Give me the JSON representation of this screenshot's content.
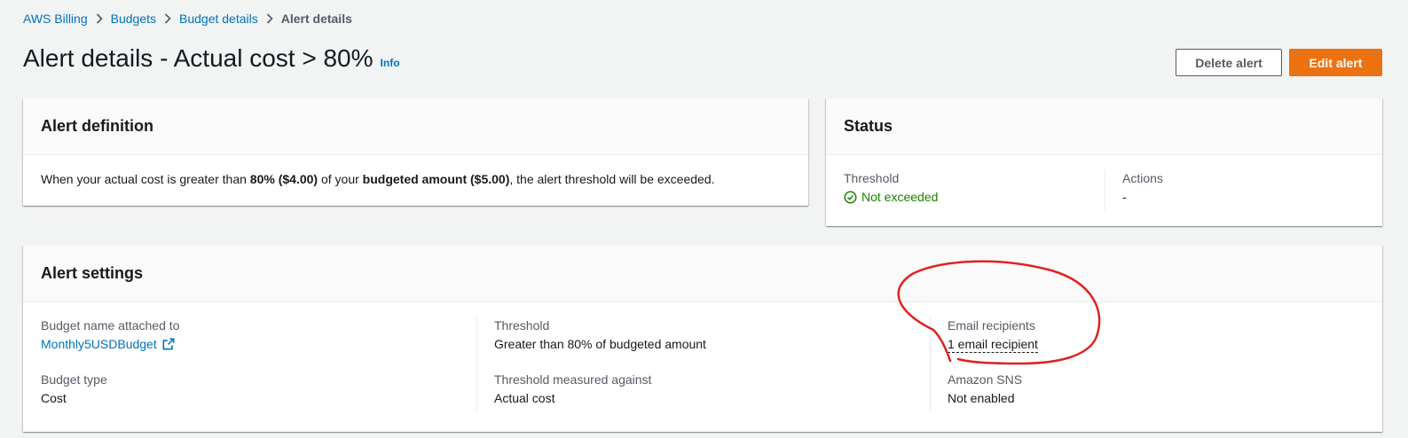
{
  "breadcrumb": {
    "items": [
      "AWS Billing",
      "Budgets",
      "Budget details"
    ],
    "current": "Alert details"
  },
  "header": {
    "title": "Alert details - Actual cost > 80%",
    "info": "Info",
    "delete_label": "Delete alert",
    "edit_label": "Edit alert"
  },
  "definition": {
    "title": "Alert definition",
    "text_pre": "When your actual cost is greater than ",
    "bold_threshold": "80% ($4.00)",
    "text_mid": " of your ",
    "bold_budget": "budgeted amount ($5.00)",
    "text_post": ", the alert threshold will be exceeded."
  },
  "status": {
    "title": "Status",
    "threshold_label": "Threshold",
    "threshold_value": "Not exceeded",
    "actions_label": "Actions",
    "actions_value": "-"
  },
  "settings": {
    "title": "Alert settings",
    "budget_name_label": "Budget name attached to",
    "budget_name_value": "Monthly5USDBudget",
    "budget_type_label": "Budget type",
    "budget_type_value": "Cost",
    "threshold_label": "Threshold",
    "threshold_value": "Greater than 80% of budgeted amount",
    "measured_label": "Threshold measured against",
    "measured_value": "Actual cost",
    "email_label": "Email recipients",
    "email_value": "1 email recipient",
    "sns_label": "Amazon SNS",
    "sns_value": "Not enabled"
  },
  "colors": {
    "link": "#0073bb",
    "primary_button": "#ec7211",
    "success": "#1d8102",
    "annotation": "#e0221f"
  },
  "icons": [
    "chevron-right-icon",
    "check-circle-icon",
    "external-link-icon"
  ]
}
